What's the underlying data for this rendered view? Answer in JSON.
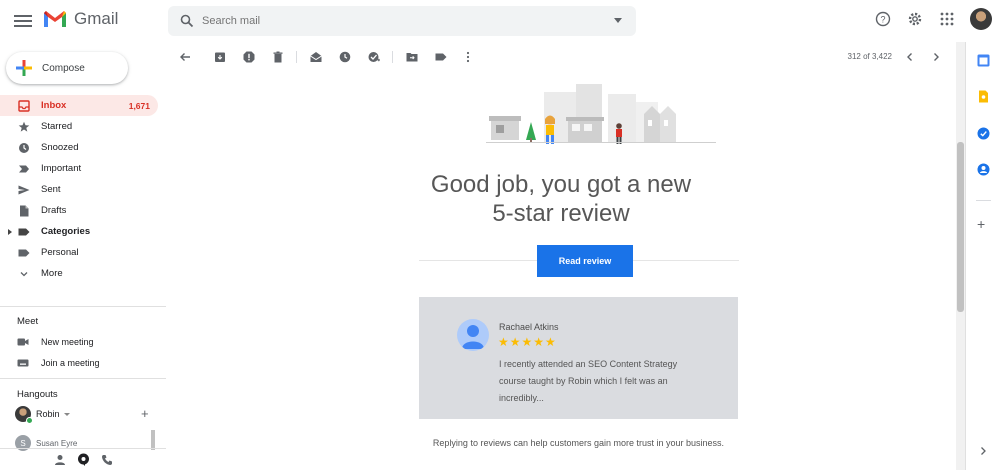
{
  "app": {
    "name": "Gmail"
  },
  "search": {
    "placeholder": "Search mail"
  },
  "compose": {
    "label": "Compose"
  },
  "nav": [
    {
      "label": "Inbox",
      "count": "1,671",
      "icon": "inbox-icon",
      "active": true
    },
    {
      "label": "Starred",
      "icon": "star-icon"
    },
    {
      "label": "Snoozed",
      "icon": "clock-icon"
    },
    {
      "label": "Important",
      "icon": "important-icon"
    },
    {
      "label": "Sent",
      "icon": "send-icon"
    },
    {
      "label": "Drafts",
      "icon": "draft-icon"
    },
    {
      "label": "Categories",
      "icon": "label-icon",
      "bold": true
    },
    {
      "label": "Personal",
      "icon": "label-icon"
    },
    {
      "label": "More",
      "icon": "chevron-down-icon"
    }
  ],
  "meet": {
    "title": "Meet",
    "new_meeting": "New meeting",
    "join": "Join a meeting"
  },
  "hangouts": {
    "title": "Hangouts",
    "user": "Robin",
    "contact": "Susan Eyre",
    "contact_initial": "S"
  },
  "toolbar": {
    "pager": "312 of 3,422"
  },
  "email": {
    "headline_1": "Good job, you got a new",
    "headline_2": "5-star review",
    "button": "Read review",
    "reviewer": "Rachael Atkins",
    "stars": "★★★★★",
    "review": "I recently attended an SEO Content Strategy course taught by Robin which I felt was an incredibly...",
    "reply_note": "Replying to reviews can help customers gain more trust in your business."
  },
  "colors": {
    "accent": "#1a73e8",
    "inbox_active_bg": "#fce8e6",
    "inbox_active_text": "#d93025",
    "star": "#fbbc04"
  }
}
